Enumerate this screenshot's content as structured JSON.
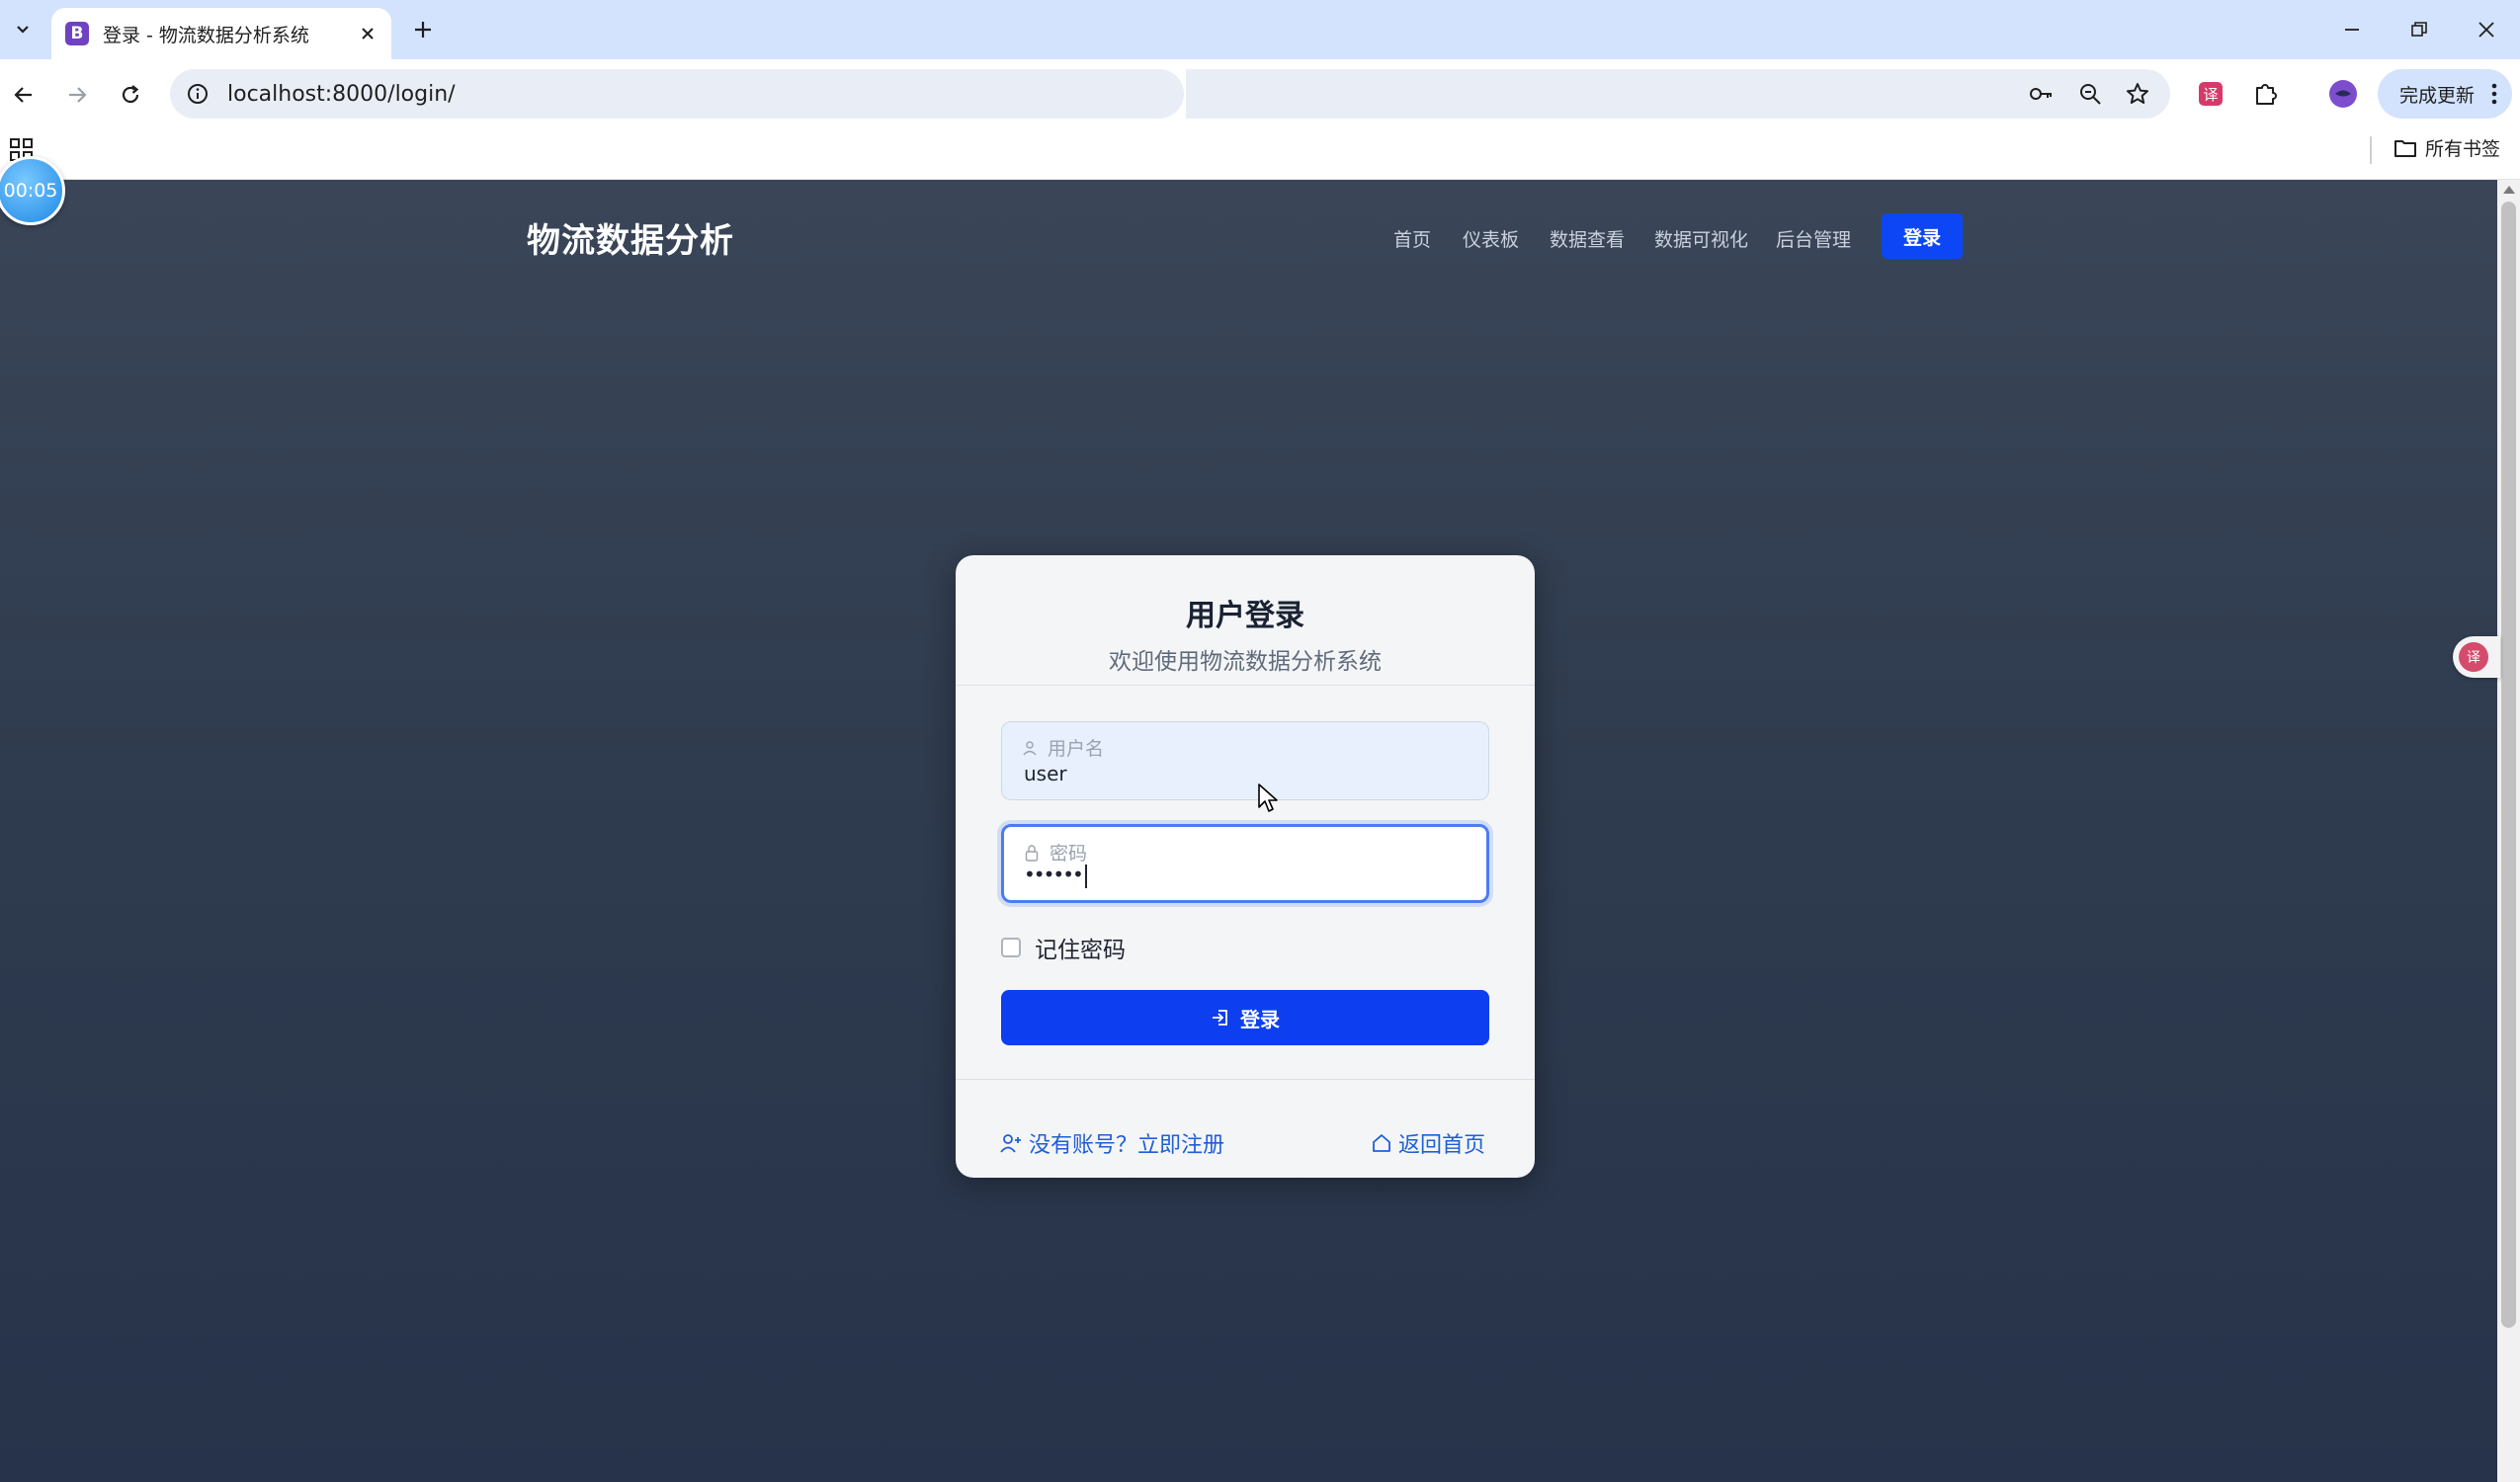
{
  "browser": {
    "tab_title": "登录 - 物流数据分析系统",
    "favicon_letter": "B",
    "url": "localhost:8000/login/",
    "update_button": "完成更新",
    "bookmarks_all": "所有书签"
  },
  "overlay": {
    "timer": "00:05"
  },
  "site": {
    "brand": "物流数据分析",
    "nav": [
      "首页",
      "仪表板",
      "数据查看",
      "数据可视化",
      "后台管理"
    ],
    "nav_login": "登录"
  },
  "login": {
    "title": "用户登录",
    "subtitle": "欢迎使用物流数据分析系统",
    "username_label": "用户名",
    "username_value": "user",
    "password_label": "密码",
    "password_value": "••••••",
    "remember_label": "记住密码",
    "submit_label": "登录",
    "register_link": "没有账号？立即注册",
    "home_link": "返回首页"
  },
  "colors": {
    "primary": "#0d3ff0",
    "page_bg": "#2f3b4e",
    "card_bg": "#f4f5f7",
    "link": "#1e5fd6"
  }
}
